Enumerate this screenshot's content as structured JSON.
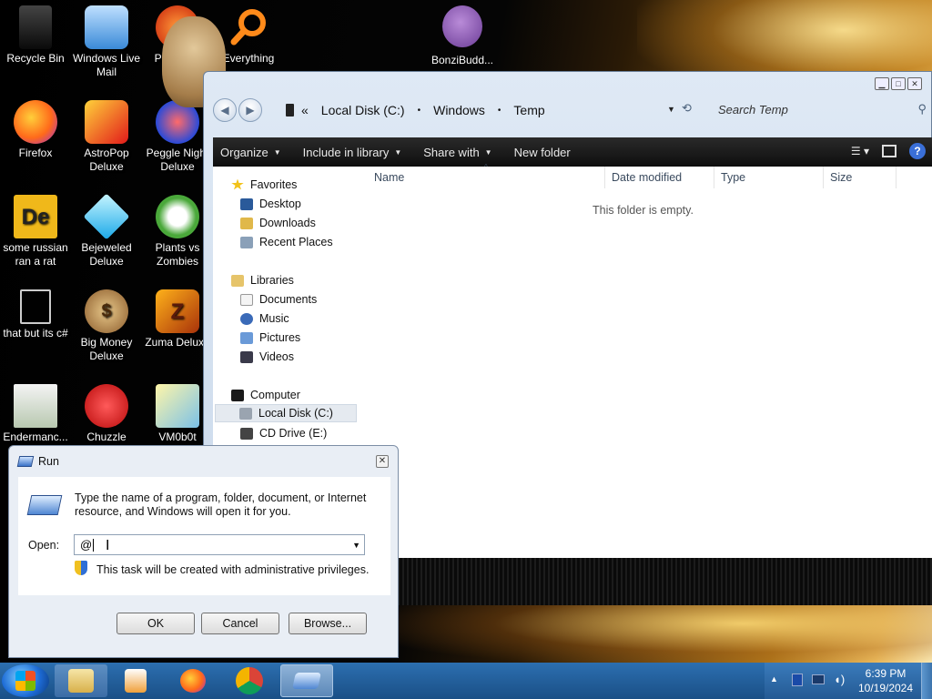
{
  "desktop": {
    "icons": [
      {
        "label": "Recycle Bin",
        "icon": "recycle-bin-icon"
      },
      {
        "label": "Windows Live Mail",
        "icon": "mail-icon"
      },
      {
        "label": "Peggle of Wa...",
        "icon": "peggle-icon"
      },
      {
        "label": "Everything",
        "icon": "search-icon"
      },
      {
        "label": "Firefox",
        "icon": "firefox-icon"
      },
      {
        "label": "AstroPop Deluxe",
        "icon": "astropop-icon"
      },
      {
        "label": "Peggle Night Deluxe",
        "icon": "peggle-nights-icon"
      },
      {
        "label": "some russian ran a rat",
        "icon": "de-icon"
      },
      {
        "label": "Bejeweled Deluxe",
        "icon": "gem-icon"
      },
      {
        "label": "Plants vs Zombies",
        "icon": "plant-icon"
      },
      {
        "label": "that but its c#",
        "icon": "windows-stack-icon"
      },
      {
        "label": "Big Money Deluxe",
        "icon": "money-bag-icon"
      },
      {
        "label": "Zuma Deluxe",
        "icon": "zuma-icon"
      },
      {
        "label": "Endermanc...",
        "icon": "app-window-icon"
      },
      {
        "label": "Chuzzle",
        "icon": "chuzzle-icon"
      },
      {
        "label": "VM0b0t",
        "icon": "vm-icon"
      }
    ],
    "bonzi_label": "BonziBudd..."
  },
  "explorer": {
    "breadcrumb": {
      "chevron": "«",
      "items": [
        "Local Disk (C:)",
        "Windows",
        "Temp"
      ],
      "separator": "•"
    },
    "search_placeholder": "Search Temp",
    "toolbar": {
      "organize": "Organize",
      "include_in_library": "Include in library",
      "share_with": "Share with",
      "new_folder": "New folder"
    },
    "nav": {
      "favorites": "Favorites",
      "desktop": "Desktop",
      "downloads": "Downloads",
      "recent_places": "Recent Places",
      "libraries": "Libraries",
      "documents": "Documents",
      "music": "Music",
      "pictures": "Pictures",
      "videos": "Videos",
      "computer": "Computer",
      "local_disk": "Local Disk (C:)",
      "cd_drive": "CD Drive (E:)"
    },
    "columns": {
      "name": "Name",
      "date_modified": "Date modified",
      "type": "Type",
      "size": "Size"
    },
    "empty_message": "This folder is empty."
  },
  "run_dialog": {
    "title": "Run",
    "message": "Type the name of a program, folder, document, or Internet resource, and Windows will open it for you.",
    "open_label": "Open:",
    "open_value": "@",
    "admin_note": "This task will be created with administrative privileges.",
    "ok": "OK",
    "cancel": "Cancel",
    "browse": "Browse..."
  },
  "taskbar": {
    "time": "6:39 PM",
    "date": "10/19/2024"
  },
  "colors": {
    "toolbar_bg": "#1a1a1a",
    "taskbar_bg": "#2c6fb0",
    "explorer_frame": "#c9d8ea"
  }
}
